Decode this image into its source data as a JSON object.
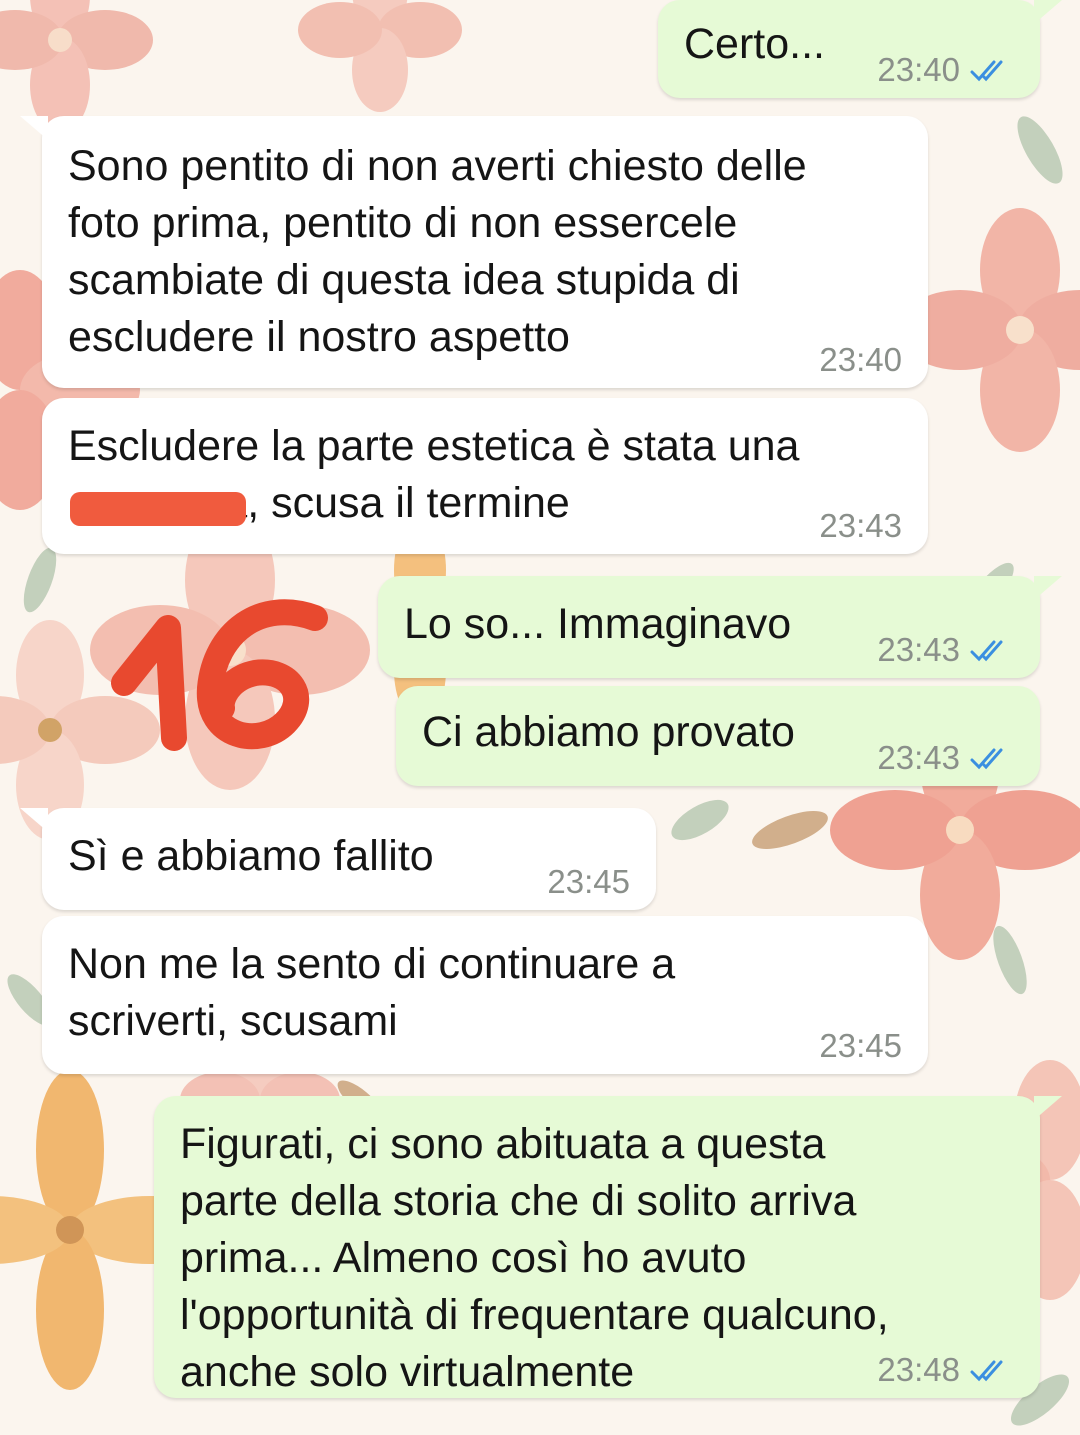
{
  "colors": {
    "incoming_bubble": "#ffffff",
    "outgoing_bubble": "#e6fad6",
    "read_ticks": "#3b8fe0",
    "redaction": "#f05b3e",
    "annotation": "#e8492f"
  },
  "messages": [
    {
      "text": "Certo...",
      "time": "23:40",
      "ticks": "read-double-check-icon"
    },
    {
      "text": "Sono pentito di non averti chiesto delle\nfoto prima, pentito di non essercele\nscambiate di questa idea stupida di\nescludere il nostro aspetto",
      "time": "23:40"
    },
    {
      "text": "Escludere la parte estetica è stata una\n             a, scusa il termine",
      "time": "23:43",
      "redacted": true
    },
    {
      "text": "Lo so... Immaginavo",
      "time": "23:43",
      "ticks": "read-double-check-icon"
    },
    {
      "text": "Ci abbiamo provato",
      "time": "23:43",
      "ticks": "read-double-check-icon"
    },
    {
      "text": "Sì e abbiamo fallito",
      "time": "23:45"
    },
    {
      "text": "Non me la sento di continuare a\nscriverti, scusami",
      "time": "23:45"
    },
    {
      "text": "Figurati, ci sono abituata a questa\nparte della storia che di solito arriva\nprima... Almeno così ho avuto\nl'opportunità di frequentare qualcuno,\nanche solo virtualmente",
      "time": "23:48",
      "ticks": "read-double-check-icon"
    }
  ],
  "annotation": {
    "text": "16"
  }
}
